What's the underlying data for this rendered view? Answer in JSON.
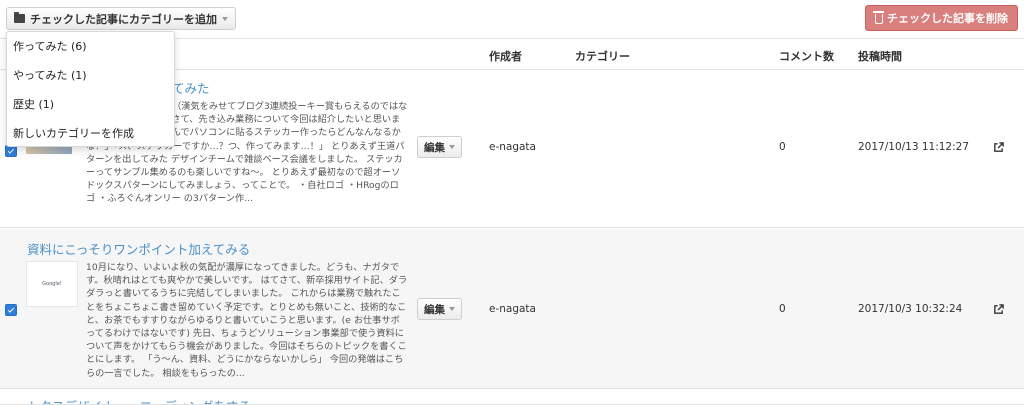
{
  "toolbar": {
    "add_category_label": "チェックした記事にカテゴリーを追加",
    "delete_label": "チェックした記事を削除"
  },
  "dropdown": {
    "items": [
      {
        "label": "作ってみた (6)"
      },
      {
        "label": "やってみた (1)"
      },
      {
        "label": "歴史 (1)"
      },
      {
        "label": "新しいカテゴリーを作成"
      }
    ]
  },
  "table": {
    "headers": {
      "author": "作成者",
      "category": "カテゴリー",
      "comments": "コメント数",
      "posted_at": "投稿時間"
    },
    "rows": [
      {
        "title": "てみた",
        "excerpt": "チームのナガタです。（漢気をみせてブログ3連続投ーキー賞もらえるのではないでしょうか？！） さて、先き込み業務について今回は紹介したいと思います〜。 ねえ、ふろぐんでパソコンに貼るステッカー作ったらどんなんなるかな？」「ス、ステッカーですか…？つ、作ってみます…！」 とりあえず王道パターンを出してみた デザインチームで雑談ベース会議をしました。 ステッカーってサンプル集めるのも楽しいですね〜。 とりあえず最初なので超オーソドックスパターンにしてみましょう、ってことで。 ・自社ロゴ ・HRogのロゴ ・ふろぐんオンリー の3パターン作...",
        "edit_label": "編集",
        "author": "e-nagata",
        "category": "",
        "comments": "0",
        "posted_at": "2017/10/13 11:12:27",
        "checked": true
      },
      {
        "title": "資料にこっそりワンポイント加えてみる",
        "thumb_text": "Googlе!",
        "excerpt": "10月になり、いよいよ秋の気配が濃厚になってきました。どうも、ナガタです。秋晴れはとても爽やかで美しいです。 はてさて、新卒採用サイト記、ダラダラっと書いてるうちに完結してしまいました。 これからは業務で触れたことをちょこちょこ書き留めていく予定です。とりとめも無いこと、技術的なこと、お茶でもすすりながらゆるりと書いていこうと思います。(e お仕事サボってるわけではないです) 先日、ちょうどソリューション事業部で使う資料について声をかけてもらう機会がありました。今回はそちらのトピックを書くことにします。 「う〜ん、資料、どうにかならないかしら」 今回の発端はこちらの一言でした。 相談をもらったの...",
        "edit_label": "編集",
        "author": "e-nagata",
        "category": "",
        "comments": "0",
        "posted_at": "2017/10/3 10:32:24",
        "checked": true
      },
      {
        "title": "トタスデザイナー・コーディングをする"
      }
    ]
  },
  "colors": {
    "link": "#4a90c8",
    "danger": "#d9807e",
    "checkbox": "#2f7fd9"
  },
  "icons": {
    "add_category": "folder-icon",
    "delete": "trash-icon",
    "open": "external-link-icon"
  }
}
